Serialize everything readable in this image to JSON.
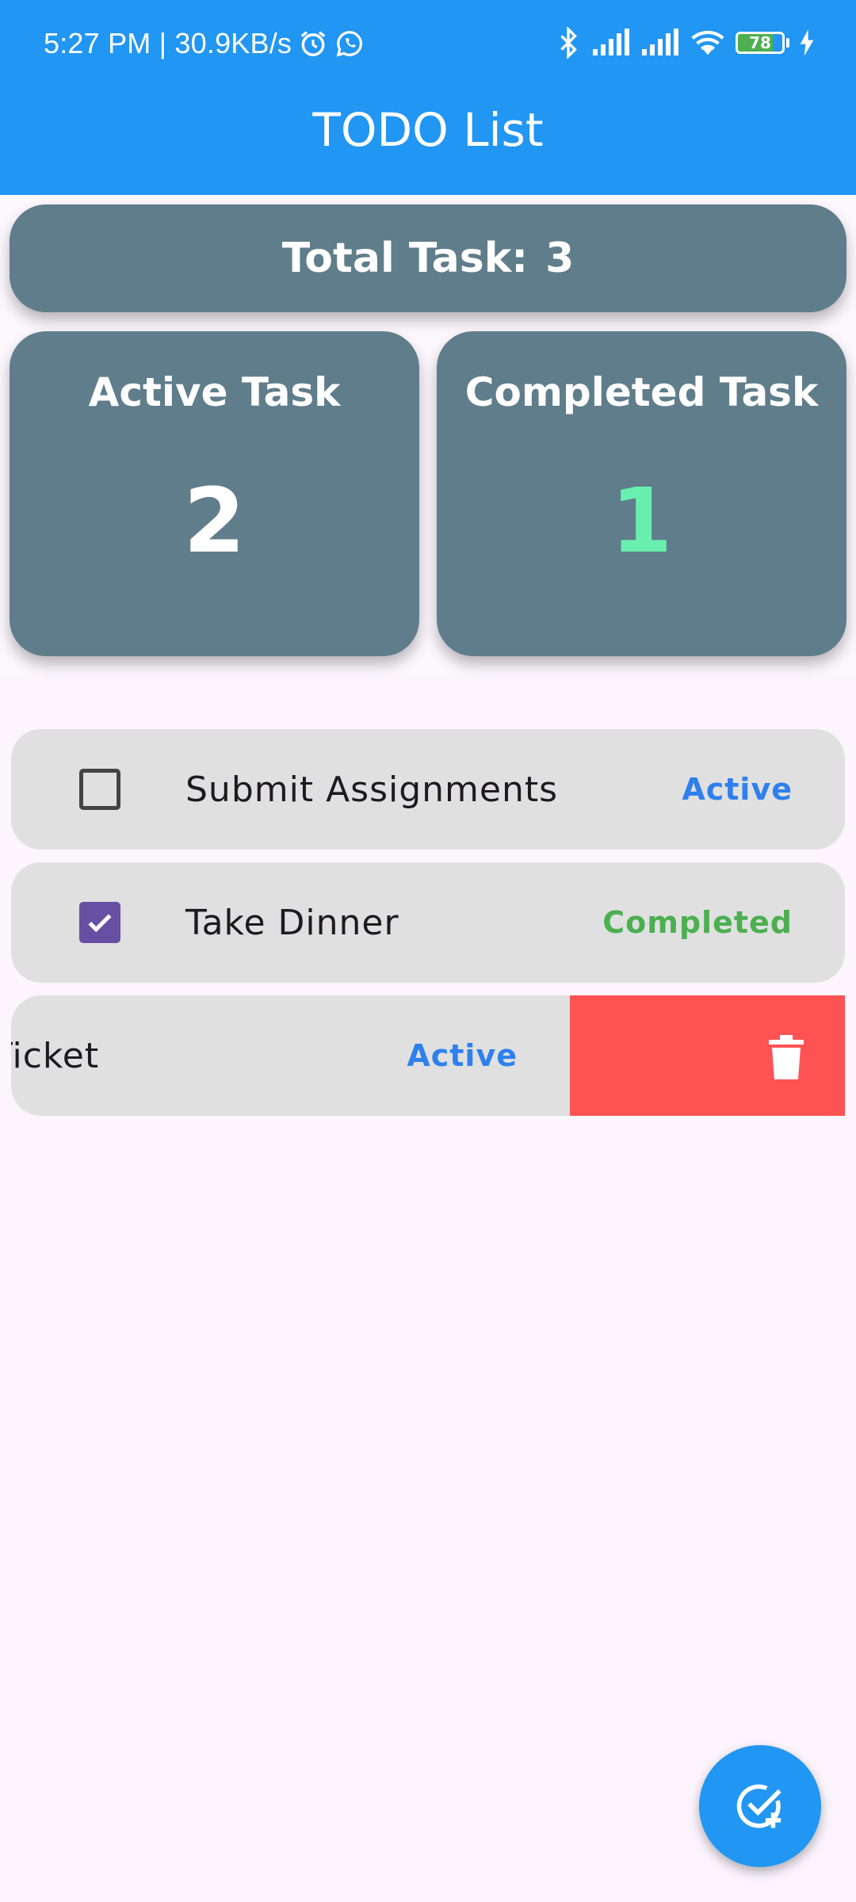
{
  "status_bar": {
    "time_speed": "5:27 PM | 30.9KB/s",
    "icons": [
      "alarm-icon",
      "whatsapp-icon",
      "bluetooth-icon",
      "signal-icon",
      "signal-icon",
      "wifi-icon",
      "battery-icon",
      "charging-icon"
    ],
    "battery_level": "78",
    "battery_fraction": 0.78
  },
  "app_bar": {
    "title": "TODO List",
    "color": "#2196f3"
  },
  "summary": {
    "total_label": "Total Task:",
    "total_value": "3",
    "active_label": "Active Task",
    "active_value": "2",
    "completed_label": "Completed Task",
    "completed_value": "1",
    "card_color": "#607d8b",
    "completed_value_color": "#69f0ae"
  },
  "tasks": [
    {
      "title": "Submit Assignments",
      "status": "Active",
      "checked": false
    },
    {
      "title": "Take Dinner",
      "status": "Completed",
      "checked": true
    },
    {
      "title": "ase Ticket",
      "status": "Active",
      "checked": false,
      "swiped": true
    }
  ],
  "colors": {
    "active_status": "#2f80ed",
    "completed_status": "#4caf50",
    "delete_background": "#ff5252",
    "checkbox_checked": "#6750a4"
  },
  "icons": {
    "delete": "trash-icon",
    "fab": "add-task-icon"
  }
}
